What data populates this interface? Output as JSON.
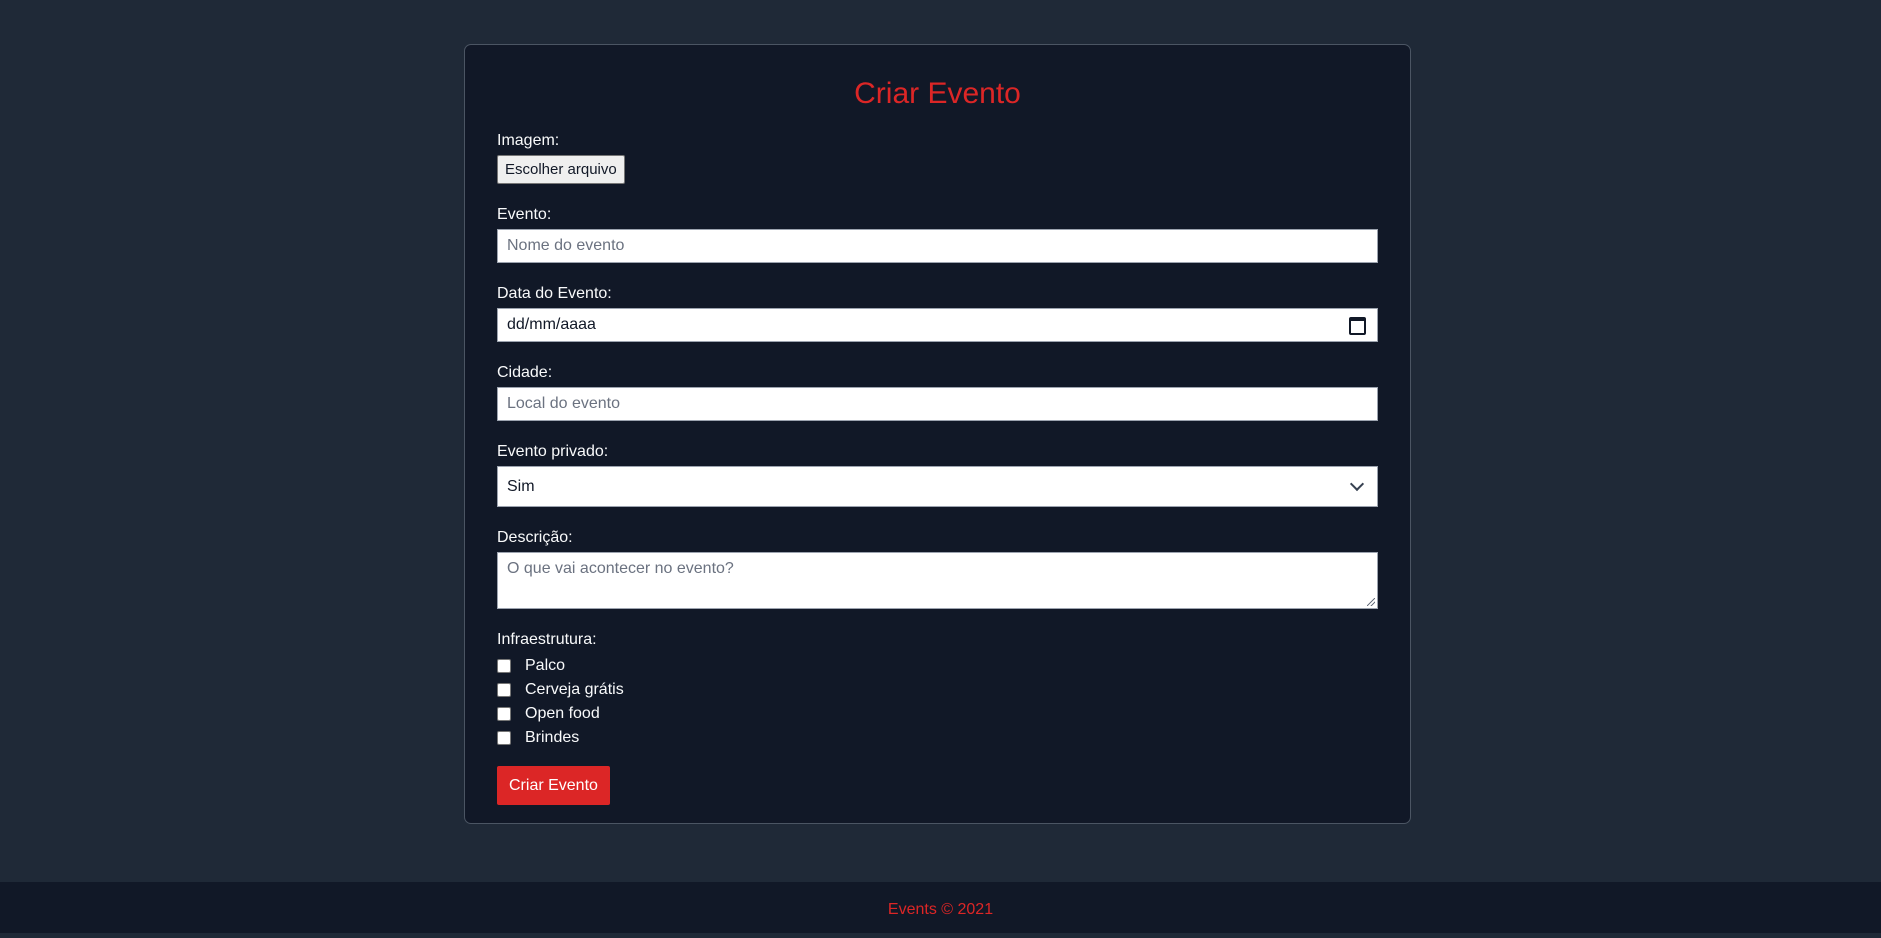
{
  "form": {
    "title": "Criar Evento",
    "image_label": "Imagem:",
    "file_button": "Escolher arquivo",
    "event_label": "Evento:",
    "event_placeholder": "Nome do evento",
    "date_label": "Data do Evento:",
    "date_value": "dd/mm/aaaa",
    "city_label": "Cidade:",
    "city_placeholder": "Local do evento",
    "private_label": "Evento privado:",
    "private_value": "Sim",
    "description_label": "Descrição:",
    "description_placeholder": "O que vai acontecer no evento?",
    "infra_label": "Infraestrutura:",
    "infra_items": [
      {
        "label": "Palco",
        "checked": false
      },
      {
        "label": "Cerveja grátis",
        "checked": false
      },
      {
        "label": "Open food",
        "checked": false
      },
      {
        "label": "Brindes",
        "checked": false
      }
    ],
    "submit_label": "Criar Evento"
  },
  "footer": {
    "text": "Events © 2021"
  },
  "colors": {
    "accent": "#dc2626",
    "page_background": "#1f2937",
    "card_background": "#111827"
  },
  "icons": {
    "date_picker": "calendar-icon",
    "select": "chevron-down-icon"
  }
}
